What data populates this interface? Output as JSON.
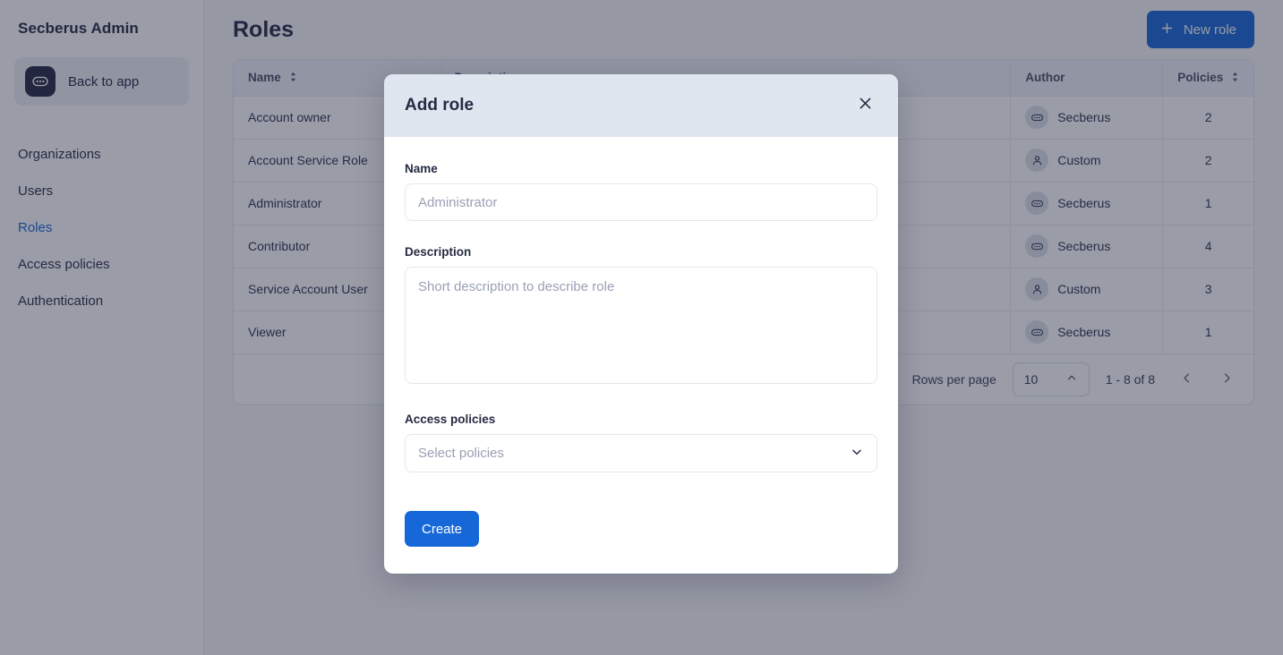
{
  "sidebar": {
    "brand": "Secberus Admin",
    "back_to_app": {
      "label": "Back to app",
      "icon": "secberus-logo-icon"
    },
    "items": [
      {
        "label": "Organizations",
        "active": false
      },
      {
        "label": "Users",
        "active": false
      },
      {
        "label": "Roles",
        "active": true
      },
      {
        "label": "Access policies",
        "active": false
      },
      {
        "label": "Authentication",
        "active": false
      }
    ]
  },
  "header": {
    "title": "Roles",
    "new_role_button": {
      "label": "New role",
      "icon": "plus-icon"
    }
  },
  "table": {
    "columns": [
      {
        "label": "Name",
        "sortable": true
      },
      {
        "label": "Description",
        "sortable": false
      },
      {
        "label": "Author",
        "sortable": false
      },
      {
        "label": "Policies",
        "sortable": true
      }
    ],
    "rows": [
      {
        "name": "Account owner",
        "description": "",
        "author": "Secberus",
        "author_icon": "secberus-logo-icon",
        "policies": "2"
      },
      {
        "name": "Account Service Role",
        "description": "",
        "author": "Custom",
        "author_icon": "person-icon",
        "policies": "2"
      },
      {
        "name": "Administrator",
        "description": "",
        "author": "Secberus",
        "author_icon": "secberus-logo-icon",
        "policies": "1"
      },
      {
        "name": "Contributor",
        "description": "",
        "author": "Secberus",
        "author_icon": "secberus-logo-icon",
        "policies": "4"
      },
      {
        "name": "Service Account User",
        "description": "",
        "author": "Custom",
        "author_icon": "person-icon",
        "policies": "3"
      },
      {
        "name": "Viewer",
        "description": "",
        "author": "Secberus",
        "author_icon": "secberus-logo-icon",
        "policies": "1"
      }
    ]
  },
  "pagination": {
    "per_page_label": "Rows per page",
    "per_page_value": "10",
    "range_text": "1 - 8 of 8",
    "prev_icon": "chevron-left-icon",
    "next_icon": "chevron-right-icon"
  },
  "modal": {
    "title": "Add role",
    "close_icon": "close-icon",
    "name": {
      "label": "Name",
      "value": "",
      "placeholder": "Administrator"
    },
    "description": {
      "label": "Description",
      "value": "",
      "placeholder": "Short description to describe role"
    },
    "access_policies": {
      "label": "Access policies",
      "placeholder": "Select policies",
      "chevron_icon": "chevron-down-icon"
    },
    "submit_label": "Create"
  },
  "colors": {
    "accent_blue": "#1668d8",
    "modal_header_bg": "#dfe6ef",
    "dark_navy": "#262b43",
    "overlay": "rgba(31,36,60,0.45)"
  }
}
